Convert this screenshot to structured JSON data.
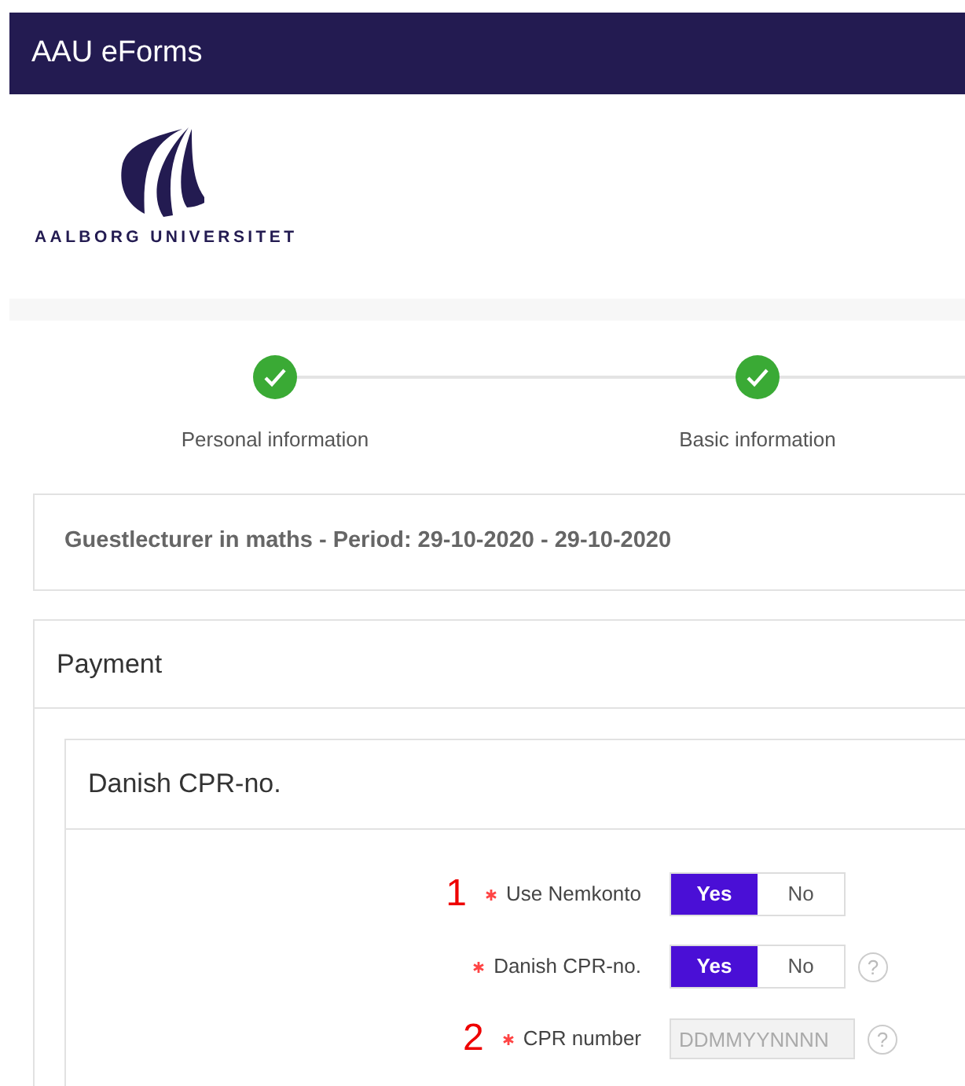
{
  "navbar": {
    "title": "AAU eForms"
  },
  "logo": {
    "text": "AALBORG UNIVERSITET"
  },
  "steps": [
    {
      "label": "Personal information",
      "done": true
    },
    {
      "label": "Basic information",
      "done": true
    }
  ],
  "summary": {
    "text": "Guestlecturer in maths - Period: 29-10-2020 - 29-10-2020"
  },
  "payment": {
    "title": "Payment",
    "section": {
      "title": "Danish CPR-no.",
      "fields": [
        {
          "kind": "toggle",
          "annotation": "1",
          "label": "Use Nemkonto",
          "required": true,
          "options": [
            {
              "label": "Yes",
              "selected": true
            },
            {
              "label": "No",
              "selected": false
            }
          ]
        },
        {
          "kind": "toggle",
          "label": "Danish CPR-no.",
          "required": true,
          "help": "?",
          "options": [
            {
              "label": "Yes",
              "selected": true
            },
            {
              "label": "No",
              "selected": false
            }
          ]
        },
        {
          "kind": "text",
          "annotation": "2",
          "label": "CPR number",
          "required": true,
          "help": "?",
          "disabled": true,
          "placeholder": "DDMMYYNNNN"
        }
      ]
    }
  }
}
